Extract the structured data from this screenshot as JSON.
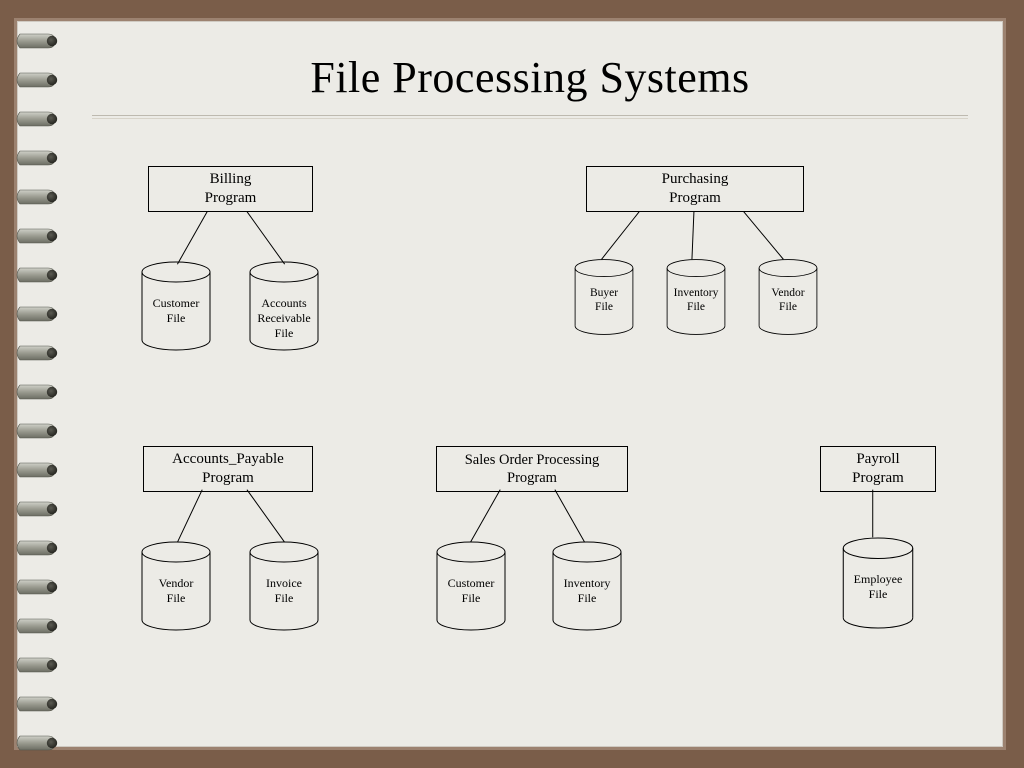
{
  "title": "File Processing Systems",
  "groups": {
    "billing": {
      "program": "Billing\nProgram",
      "files": [
        "Customer\nFile",
        "Accounts\nReceivable\nFile"
      ]
    },
    "purchasing": {
      "program": "Purchasing\nProgram",
      "files": [
        "Buyer\nFile",
        "Inventory\nFile",
        "Vendor\nFile"
      ]
    },
    "accounts_payable": {
      "program": "Accounts_Payable\nProgram",
      "files": [
        "Vendor\nFile",
        "Invoice\nFile"
      ]
    },
    "sales_order": {
      "program": "Sales Order Processing\nProgram",
      "files": [
        "Customer\nFile",
        "Inventory\nFile"
      ]
    },
    "payroll": {
      "program": "Payroll\nProgram",
      "files": [
        "Employee\nFile"
      ]
    }
  }
}
